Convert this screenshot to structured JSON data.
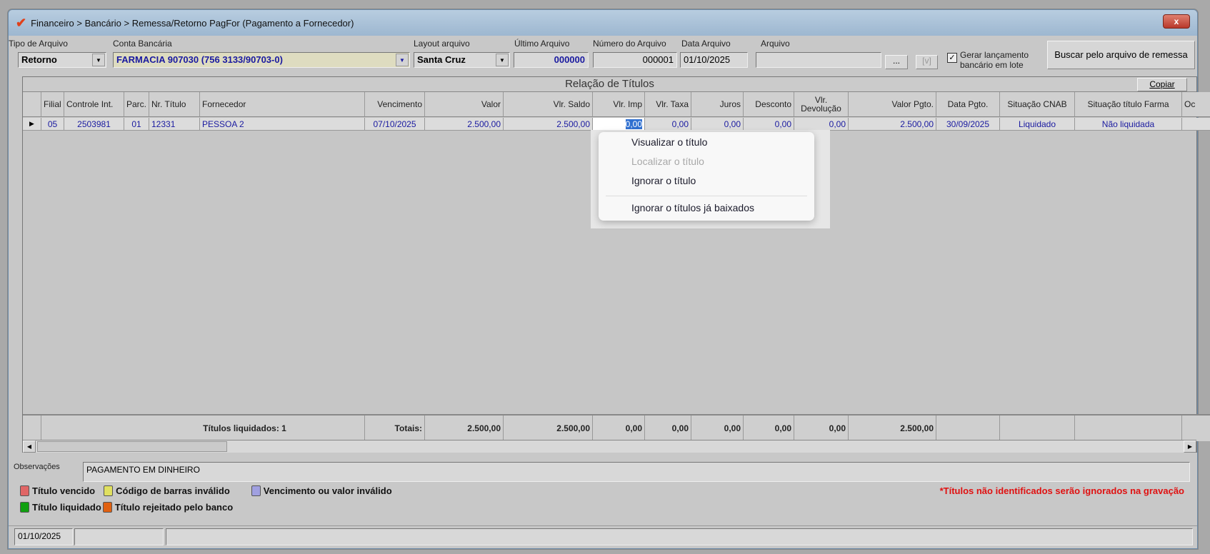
{
  "window": {
    "title": "Financeiro > Bancário > Remessa/Retorno PagFor (Pagamento  a Fornecedor)",
    "close": "x"
  },
  "form": {
    "tipo_label": "Tipo de Arquivo",
    "tipo_value": "Retorno",
    "conta_label": "Conta Bancária",
    "conta_value": "FARMACIA 907030 (756 3133/90703-0)",
    "layout_label": "Layout arquivo",
    "layout_value": "Santa Cruz",
    "ultimo_label": "Último Arquivo",
    "ultimo_value": "000000",
    "numero_label": "Número do Arquivo",
    "numero_value": "000001",
    "data_label": "Data Arquivo",
    "data_value": "01/10/2025",
    "arquivo_label": "Arquivo",
    "arquivo_value": "",
    "browse": "...",
    "verify": "[v]",
    "gerar_line1": "Gerar lançamento",
    "gerar_line2": "bancário em lote",
    "gerar_checked": true,
    "buscar": "Buscar pelo arquivo de remessa"
  },
  "grid": {
    "title": "Relação de Títulos",
    "copy": "Copiar",
    "columns": [
      "Filial",
      "Controle Int.",
      "Parc.",
      "Nr. Título",
      "Fornecedor",
      "Vencimento",
      "Valor",
      "Vlr. Saldo",
      "Vlr. Imp",
      "Vlr. Taxa",
      "Juros",
      "Desconto",
      "Vlr. Devolução",
      "Valor Pgto.",
      "Data Pgto.",
      "Situação CNAB",
      "Situação título Farma",
      "Oc"
    ],
    "rows": [
      [
        "05",
        "2503981",
        "01",
        "12331",
        "PESSOA 2",
        "07/10/2025",
        "2.500,00",
        "2.500,00",
        "0,00",
        "0,00",
        "0,00",
        "0,00",
        "0,00",
        "2.500,00",
        "30/09/2025",
        "Liquidado",
        "Não liquidada",
        ""
      ]
    ],
    "totals": {
      "liquidados": "Títulos liquidados: 1",
      "label": "Totais:",
      "valor": "2.500,00",
      "saldo": "2.500,00",
      "imp": "0,00",
      "taxa": "0,00",
      "juros": "0,00",
      "desconto": "0,00",
      "devolucao": "0,00",
      "pgto": "2.500,00"
    }
  },
  "context_menu": {
    "items": [
      "Visualizar o título",
      "Localizar o título",
      "Ignorar o título",
      "Ignorar o títulos já baixados"
    ]
  },
  "obs": {
    "label": "Observações",
    "value": "PAGAMENTO EM DINHEIRO"
  },
  "legend": [
    {
      "label": "Título vencido",
      "color": "#e06666"
    },
    {
      "label": "Código de barras inválido",
      "color": "#e0e060"
    },
    {
      "label": "Vencimento ou valor inválido",
      "color": "#a0a0e0"
    },
    {
      "label": "Título liquidado",
      "color": "#10a010"
    },
    {
      "label": "Título rejeitado pelo banco",
      "color": "#e06010"
    }
  ],
  "warning": "*Títulos não identificados serão ignorados na gravação",
  "status": {
    "date": "01/10/2025"
  }
}
